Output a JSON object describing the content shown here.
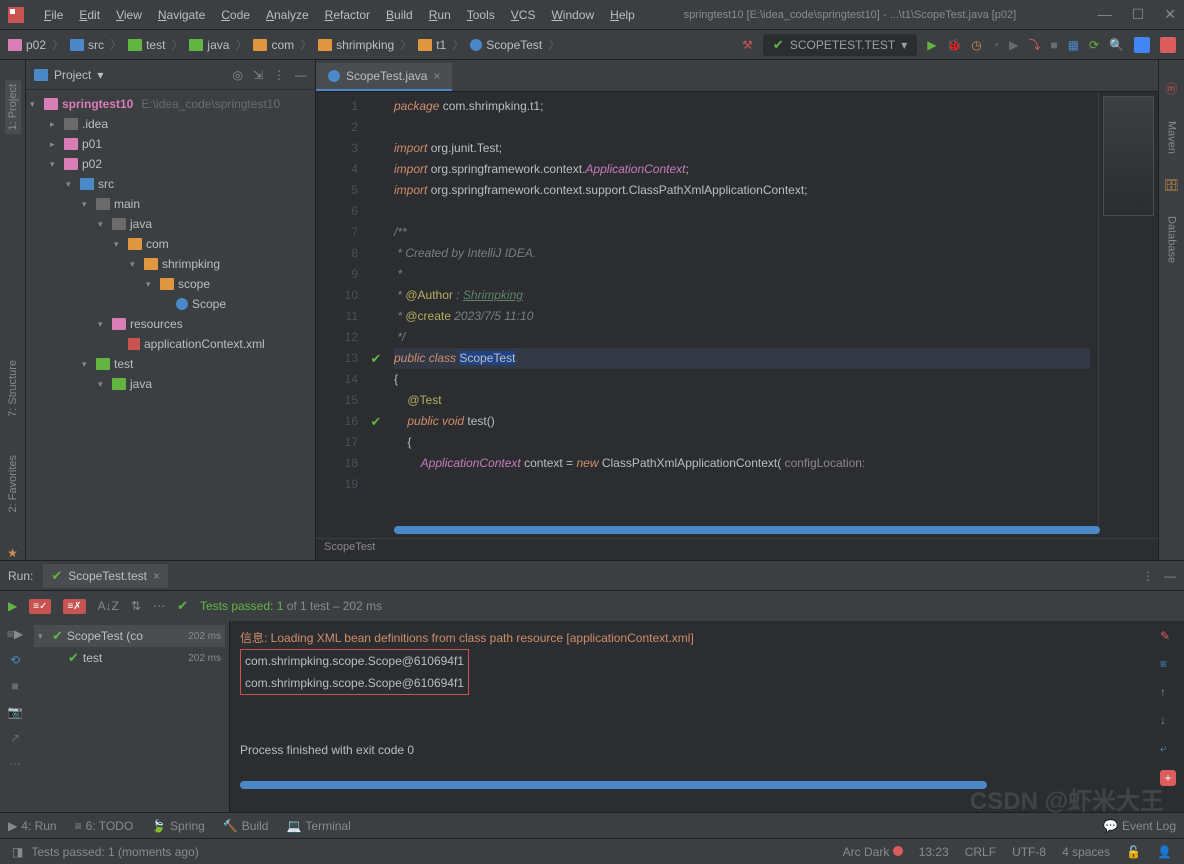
{
  "window": {
    "title": "springtest10 [E:\\idea_code\\springtest10] - ...\\t1\\ScopeTest.java [p02]"
  },
  "menu": [
    "File",
    "Edit",
    "View",
    "Navigate",
    "Code",
    "Analyze",
    "Refactor",
    "Build",
    "Run",
    "Tools",
    "VCS",
    "Window",
    "Help"
  ],
  "breadcrumb": [
    "p02",
    "src",
    "test",
    "java",
    "com",
    "shrimpking",
    "t1",
    "ScopeTest"
  ],
  "runConfig": "SCOPETEST.TEST",
  "projectPanel": {
    "title": "Project",
    "root": {
      "name": "springtest10",
      "path": "E:\\idea_code\\springtest10"
    },
    "tree": [
      {
        "indent": 1,
        "icon": "gray",
        "arrow": "▸",
        "label": ".idea"
      },
      {
        "indent": 1,
        "icon": "pink",
        "arrow": "▸",
        "label": "p01"
      },
      {
        "indent": 1,
        "icon": "pink",
        "arrow": "▾",
        "label": "p02"
      },
      {
        "indent": 2,
        "icon": "blue",
        "arrow": "▾",
        "label": "src"
      },
      {
        "indent": 3,
        "icon": "gray",
        "arrow": "▾",
        "label": "main"
      },
      {
        "indent": 4,
        "icon": "gray",
        "arrow": "▾",
        "label": "java"
      },
      {
        "indent": 5,
        "icon": "orange",
        "arrow": "▾",
        "label": "com"
      },
      {
        "indent": 6,
        "icon": "orange",
        "arrow": "▾",
        "label": "shrimpking"
      },
      {
        "indent": 7,
        "icon": "orange",
        "arrow": "▾",
        "label": "scope"
      },
      {
        "indent": 8,
        "icon": "class",
        "arrow": "",
        "label": "Scope"
      },
      {
        "indent": 4,
        "icon": "pink",
        "arrow": "▾",
        "label": "resources"
      },
      {
        "indent": 5,
        "icon": "xml",
        "arrow": "",
        "label": "applicationContext.xml"
      },
      {
        "indent": 3,
        "icon": "green",
        "arrow": "▾",
        "label": "test"
      },
      {
        "indent": 4,
        "icon": "green",
        "arrow": "▾",
        "label": "java"
      }
    ]
  },
  "editorTab": {
    "name": "ScopeTest.java"
  },
  "code": {
    "lines": [
      {
        "n": 1,
        "html": "<span class='kw'>package</span> <span class='pkg'>com.shrimpking.t1;</span>"
      },
      {
        "n": 2,
        "html": ""
      },
      {
        "n": 3,
        "html": "<span class='kw'>import</span> <span class='pkg'>org.junit.Test;</span>"
      },
      {
        "n": 4,
        "html": "<span class='kw'>import</span> <span class='pkg'>org.springframework.context.</span><span class='type'>ApplicationContext</span><span class='pkg'>;</span>"
      },
      {
        "n": 5,
        "html": "<span class='kw'>import</span> <span class='pkg'>org.springframework.context.support.ClassPathXmlApplicationContext;</span>"
      },
      {
        "n": 6,
        "html": ""
      },
      {
        "n": 7,
        "html": "<span class='cmt'>/**</span>"
      },
      {
        "n": 8,
        "html": "<span class='cmt'> * Created by IntelliJ IDEA.</span>"
      },
      {
        "n": 9,
        "html": "<span class='cmt'> *</span>"
      },
      {
        "n": 10,
        "html": "<span class='cmt'> * </span><span class='ann'>@Author</span><span class='cmt'> : </span><span class='Link'>Shrimpking</span>"
      },
      {
        "n": 11,
        "html": "<span class='cmt'> * </span><span class='ann'>@create</span><span class='cmt'> 2023/7/5 11:10</span>"
      },
      {
        "n": 12,
        "html": "<span class='cmt'> */</span>"
      },
      {
        "n": 13,
        "html": "<span class='kw'>public class</span> <span class='hlname'>ScopeTest</span>",
        "hl": true,
        "check": true
      },
      {
        "n": 14,
        "html": "<span class='pkg'>{</span>"
      },
      {
        "n": 15,
        "html": "    <span class='ann'>@Test</span>"
      },
      {
        "n": 16,
        "html": "    <span class='kw'>public void</span> <span class='classname'>test()</span>",
        "check": true
      },
      {
        "n": 17,
        "html": "    <span class='pkg'>{</span>"
      },
      {
        "n": 18,
        "html": "        <span class='type'>ApplicationContext</span> <span class='classname'>context</span> = <span class='newkw'>new</span> <span class='classname'>ClassPathXmlApplicationContext(</span> <span class='param'>configLocation:</span>"
      },
      {
        "n": 19,
        "html": ""
      }
    ],
    "breadcrumbBottom": "ScopeTest"
  },
  "runPanel": {
    "header": "Run:",
    "tab": "ScopeTest.test",
    "testSummary": {
      "prefix": "Tests passed: 1",
      "suffix": " of 1 test – 202 ms"
    },
    "testTree": [
      {
        "label": "ScopeTest (co",
        "time": "202 ms",
        "indent": 0,
        "arrow": "▾",
        "sel": true
      },
      {
        "label": "test",
        "time": "202 ms",
        "indent": 1,
        "arrow": "",
        "sel": false
      }
    ],
    "console": [
      {
        "cls": "console-info",
        "text": "信息: Loading XML bean definitions from class path resource [applicationContext.xml]"
      },
      {
        "cls": "console-out boxed",
        "text": "com.shrimpking.scope.Scope@610694f1"
      },
      {
        "cls": "console-out boxed",
        "text": "com.shrimpking.scope.Scope@610694f1"
      },
      {
        "cls": "",
        "text": ""
      },
      {
        "cls": "",
        "text": ""
      },
      {
        "cls": "console-out",
        "text": "Process finished with exit code 0"
      }
    ]
  },
  "bottomBar": [
    "4: Run",
    "6: TODO",
    "Spring",
    "Build",
    "Terminal"
  ],
  "bottomRight": "Event Log",
  "statusBar": {
    "left": "Tests passed: 1 (moments ago)",
    "theme": "Arc Dark",
    "time": "13:23",
    "lineEnding": "CRLF",
    "encoding": "UTF-8",
    "indent": "4 spaces",
    "watermark": "CSDN @虾米大王"
  },
  "leftSidebar": [
    "1: Project"
  ],
  "leftSidebarBottom": [
    "7: Structure",
    "2: Favorites"
  ],
  "rightSidebar": [
    "Maven",
    "Database"
  ]
}
